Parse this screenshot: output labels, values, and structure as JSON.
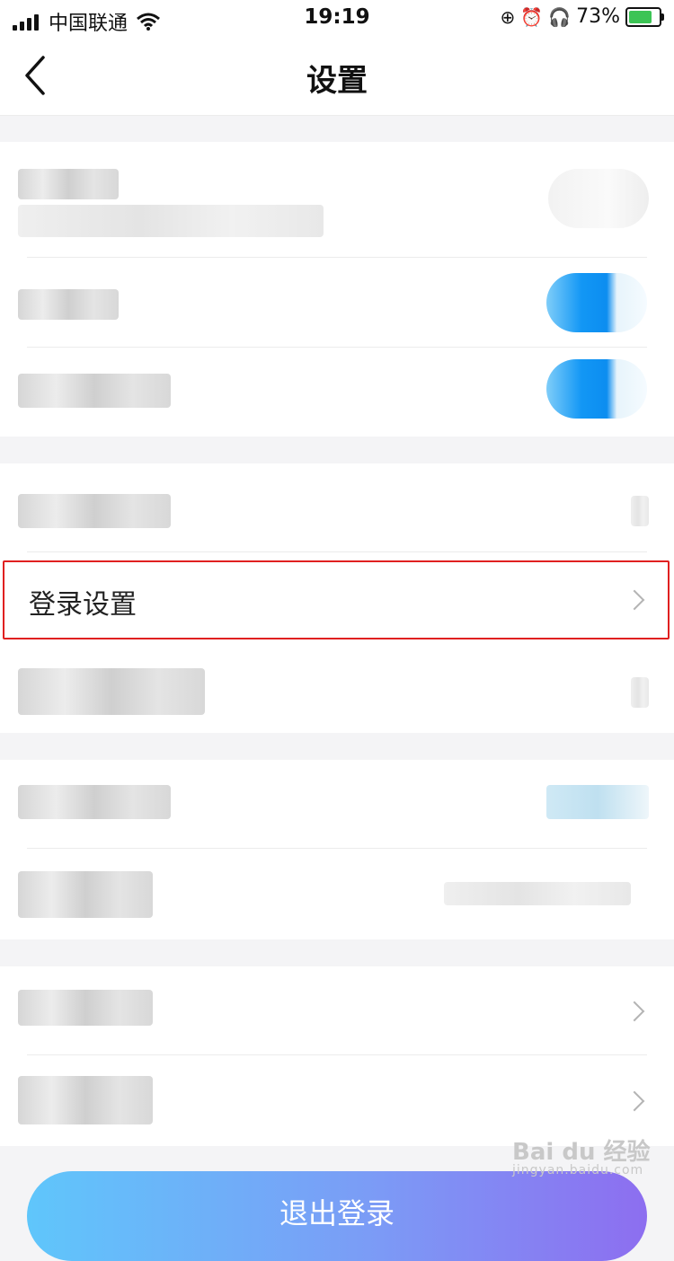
{
  "status_bar": {
    "carrier": "中国联通",
    "time": "19:19",
    "battery_percent": "73%"
  },
  "nav": {
    "title": "设置"
  },
  "rows": {
    "login_settings": "登录设置"
  },
  "footer": {
    "logout_label": "退出登录"
  },
  "watermark": {
    "main": "Bai du 经验",
    "sub": "jingyan.baidu.com"
  },
  "colors": {
    "accent_blue": "#0c8df0",
    "highlight_red": "#e02020"
  }
}
